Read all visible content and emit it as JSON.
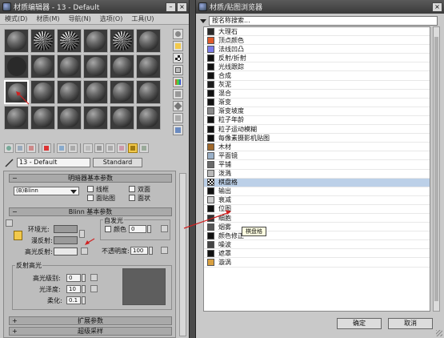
{
  "editor": {
    "title": "材质编辑器 - 13 - Default",
    "menu": [
      "模式(D)",
      "材质(M)",
      "导航(N)",
      "选项(O)",
      "工具(U)"
    ],
    "material_name": "13 - Default",
    "type_button": "Standard"
  },
  "shader_rollout": {
    "title": "明暗器基本参数",
    "shader": "(B)Blinn",
    "options": [
      "线框",
      "双面",
      "面贴图",
      "面状"
    ]
  },
  "blinn_rollout": {
    "title": "Blinn 基本参数",
    "self_illum_label": "自发光",
    "color_label": "颜色",
    "color_value": "0",
    "ambient": "环境光:",
    "diffuse": "漫反射:",
    "specular": "高光反射:",
    "opacity_label": "不透明度:",
    "opacity_value": "100"
  },
  "highlights": {
    "title": "反射高光",
    "level_label": "高光级别:",
    "level_value": "0",
    "gloss_label": "光泽度:",
    "gloss_value": "10",
    "soften_label": "柔化:",
    "soften_value": "0.1"
  },
  "extra_rollouts": [
    "扩展参数",
    "超级采样"
  ],
  "browser": {
    "title": "材质/贴图浏览器",
    "search_placeholder": "按名称搜索...",
    "ok": "确定",
    "cancel": "取消",
    "tooltip": "棋盘格",
    "items": [
      {
        "label": "大理石",
        "color": "#2a2a2a"
      },
      {
        "label": "顶点颜色",
        "color": "#e05a2a"
      },
      {
        "label": "法线凹凸",
        "color": "#7a7ae8"
      },
      {
        "label": "反射/折射",
        "color": "#111111"
      },
      {
        "label": "光线跟踪",
        "color": "#111111"
      },
      {
        "label": "合成",
        "color": "#111111"
      },
      {
        "label": "灰泥",
        "color": "#1a1a1a"
      },
      {
        "label": "混合",
        "color": "#111111"
      },
      {
        "label": "渐变",
        "color": "#111111"
      },
      {
        "label": "渐变坡度",
        "color": "#888888"
      },
      {
        "label": "粒子年龄",
        "color": "#111111"
      },
      {
        "label": "粒子运动模糊",
        "color": "#111111"
      },
      {
        "label": "每像素摄影机贴图",
        "color": "#111111"
      },
      {
        "label": "木材",
        "color": "#a0682a"
      },
      {
        "label": "平面镜",
        "color": "#9ab0c8"
      },
      {
        "label": "平铺",
        "color": "#6a6a6a"
      },
      {
        "label": "泼溅",
        "color": "#b8b8b8"
      },
      {
        "label": "棋盘格",
        "color": "#444444"
      },
      {
        "label": "输出",
        "color": "#111111"
      },
      {
        "label": "衰减",
        "color": "#cccccc"
      },
      {
        "label": "位图",
        "color": "#111111"
      },
      {
        "label": "细胞",
        "color": "#333333"
      },
      {
        "label": "烟雾",
        "color": "#555555"
      },
      {
        "label": "颜色修正",
        "color": "#111111"
      },
      {
        "label": "噪波",
        "color": "#444444"
      },
      {
        "label": "遮罩",
        "color": "#111111"
      },
      {
        "label": "漩涡",
        "color": "#d8a040"
      }
    ]
  },
  "colors": {
    "ambient_swatch": "#9a9a9a",
    "diffuse_swatch": "#9a9a9a",
    "specular_swatch": "#e8e8e8",
    "highlight_preview": "#5e5e5e",
    "accent_yellow": "#f2c94c",
    "arrow_red": "#d02020"
  }
}
